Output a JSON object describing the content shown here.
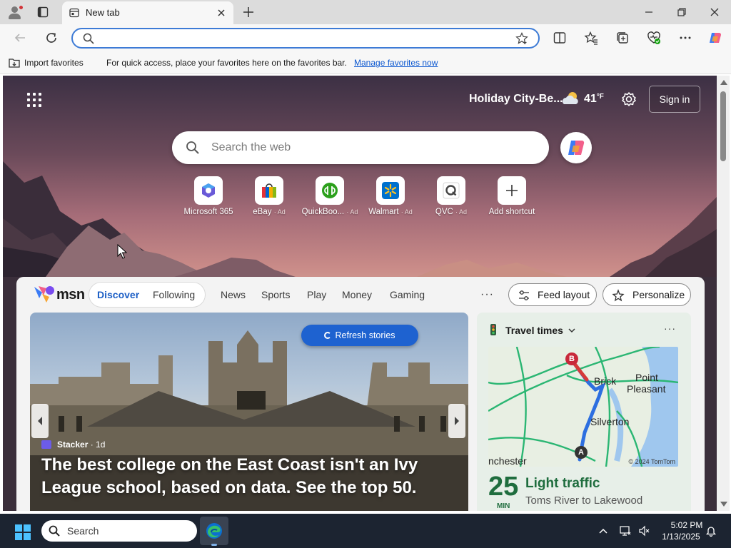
{
  "browser": {
    "tab": {
      "title": "New tab"
    },
    "address_bar": {
      "value": "",
      "placeholder": ""
    },
    "favorites_bar": {
      "import_label": "Import favorites",
      "message": "For quick access, place your favorites here on the favorites bar.",
      "manage_link": "Manage favorites now"
    }
  },
  "newtab": {
    "weather": {
      "location": "Holiday City-Be...",
      "temp": "41",
      "unit": "°F",
      "icon": "partly-cloudy-icon"
    },
    "sign_in": "Sign in",
    "search": {
      "placeholder": "Search the web"
    },
    "shortcuts": [
      {
        "label": "Microsoft 365",
        "ad": "",
        "icon": "microsoft-365-icon"
      },
      {
        "label": "eBay",
        "ad": "· Ad",
        "icon": "ebay-icon"
      },
      {
        "label": "QuickBoo...",
        "ad": "· Ad",
        "icon": "quickbooks-icon"
      },
      {
        "label": "Walmart",
        "ad": "· Ad",
        "icon": "walmart-icon"
      },
      {
        "label": "QVC",
        "ad": "· Ad",
        "icon": "qvc-icon"
      },
      {
        "label": "Add shortcut",
        "ad": "",
        "icon": "plus-icon"
      }
    ]
  },
  "feed": {
    "brand": "msn",
    "tabs": [
      "Discover",
      "Following"
    ],
    "nav": [
      "News",
      "Sports",
      "Play",
      "Money",
      "Gaming"
    ],
    "more": "···",
    "feed_layout": "Feed layout",
    "personalize": "Personalize",
    "hero": {
      "refresh": "Refresh stories",
      "source": "Stacker",
      "age": "· 1d",
      "title": "The best college on the East Coast isn't an Ivy League school, based on data. See the top 50."
    },
    "travel": {
      "title": "Travel times",
      "more": "···",
      "map_labels": {
        "marker_a": "A",
        "marker_b": "B",
        "brick": "Brick",
        "point_pleasant_1": "Point",
        "point_pleasant_2": "Pleasant",
        "silverton": "Silverton",
        "manchester": "nchester"
      },
      "copyright": "© 2024 TomTom",
      "minutes": "25",
      "minutes_unit": "MIN",
      "status": "Light traffic",
      "route": "Toms River to Lakewood"
    }
  },
  "taskbar": {
    "search_label": "Search",
    "time": "5:02 PM",
    "date": "1/13/2025"
  },
  "colors": {
    "accent": "#1e62d0",
    "traffic_green": "#1f6d3e",
    "taskbar": "#1c2431"
  }
}
